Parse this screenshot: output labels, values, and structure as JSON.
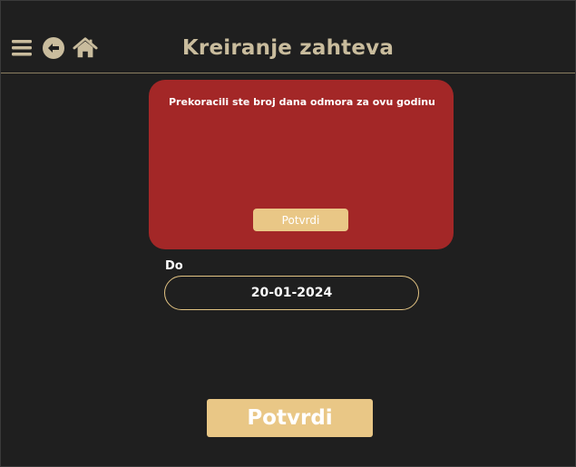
{
  "header": {
    "title": "Kreiranje zahteva",
    "icons": [
      "hamburger-menu-icon",
      "back-arrow-icon",
      "home-icon"
    ],
    "icon_color": "#c9bc9d"
  },
  "alert": {
    "message": "Prekoracili ste broj dana odmora za ovu godinu",
    "button_label": "Potvrdi",
    "background_color": "#a32727",
    "button_color": "#e9c786"
  },
  "form": {
    "date_label": "Do",
    "date_value": "20-01-2024",
    "submit_label": "Potvrdi",
    "accent_color": "#e9c786"
  }
}
